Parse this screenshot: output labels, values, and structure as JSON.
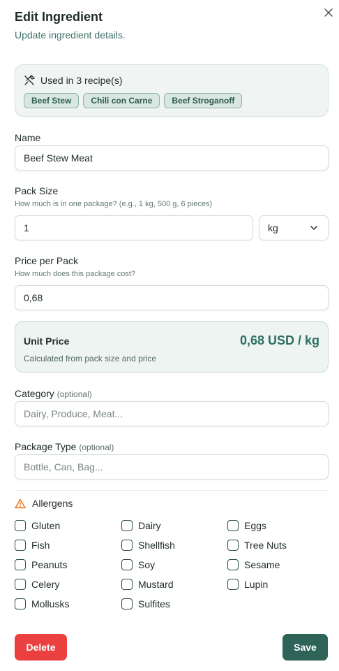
{
  "dialog": {
    "title": "Edit Ingredient",
    "subtitle": "Update ingredient details."
  },
  "usage": {
    "icon": "utensils-crossed-icon",
    "text": "Used in 3 recipe(s)",
    "recipes": [
      "Beef Stew",
      "Chili con Carne",
      "Beef Stroganoff"
    ]
  },
  "fields": {
    "name": {
      "label": "Name",
      "value": "Beef Stew Meat"
    },
    "pack_size": {
      "label": "Pack Size",
      "hint": "How much is in one package? (e.g., 1 kg, 500 g, 6 pieces)",
      "value": "1",
      "unit": "kg"
    },
    "price": {
      "label": "Price per Pack",
      "hint": "How much does this package cost?",
      "value": "0,68"
    },
    "category": {
      "label": "Category",
      "optional": "(optional)",
      "placeholder": "Dairy, Produce, Meat..."
    },
    "package_type": {
      "label": "Package Type",
      "optional": "(optional)",
      "placeholder": "Bottle, Can, Bag..."
    }
  },
  "unit_price": {
    "label": "Unit Price",
    "value": "0,68 USD / kg",
    "note": "Calculated from pack size and price"
  },
  "allergens": {
    "title": "Allergens",
    "items": [
      "Gluten",
      "Dairy",
      "Eggs",
      "Fish",
      "Shellfish",
      "Tree Nuts",
      "Peanuts",
      "Soy",
      "Sesame",
      "Celery",
      "Mustard",
      "Lupin",
      "Mollusks",
      "Sulfites"
    ]
  },
  "actions": {
    "delete": "Delete",
    "save": "Save"
  },
  "colors": {
    "accent": "#2d6457",
    "danger": "#ea4040",
    "warning": "#e8701a"
  }
}
